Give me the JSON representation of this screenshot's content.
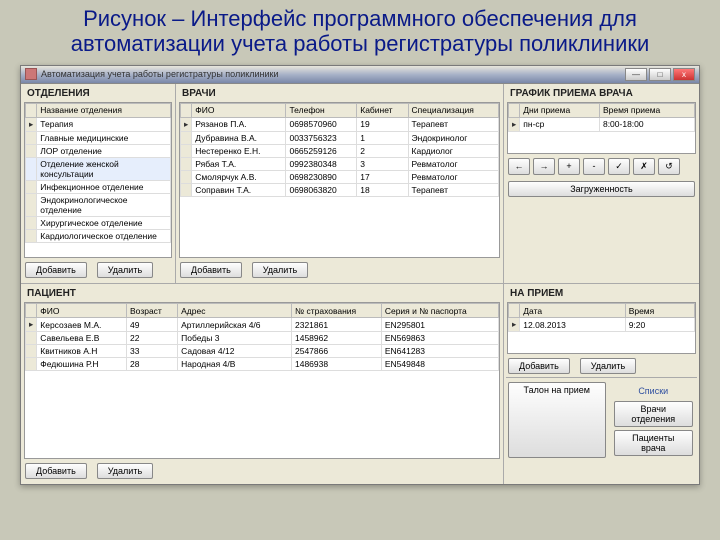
{
  "slide_title": "Рисунок – Интерфейс программного обеспечения для автоматизации учета работы регистратуры поликлиники",
  "window": {
    "title": "Автоматизация учета работы регистратуры поликлиники",
    "min": "—",
    "max": "□",
    "close": "x"
  },
  "dep": {
    "header": "ОТДЕЛЕНИЯ",
    "col": "Название отделения",
    "rows": [
      "Терапия",
      "Главные медицинские",
      "ЛОР отделение",
      "Отделение женской консультации",
      "Инфекционное отделение",
      "Эндокринологическое отделение",
      "Хирургическое отделение",
      "Кардиологическое отделение"
    ],
    "add": "Добавить",
    "del": "Удалить"
  },
  "doc": {
    "header": "ВРАЧИ",
    "cols": [
      "ФИО",
      "Телефон",
      "Кабинет",
      "Специализация"
    ],
    "rows": [
      [
        "Рязанов П.А.",
        "0698570960",
        "19",
        "Терапевт"
      ],
      [
        "Дубравина В.А.",
        "0033756323",
        "1",
        "Эндокринолог"
      ],
      [
        "Нестеренко Е.Н.",
        "0665259126",
        "2",
        "Кардиолог"
      ],
      [
        "Рябая Т.А.",
        "0992380348",
        "3",
        "Ревматолог"
      ],
      [
        "Смолярчук А.В.",
        "0698230890",
        "17",
        "Ревматолог"
      ],
      [
        "Соправин Т.А.",
        "0698063820",
        "18",
        "Терапевт"
      ]
    ],
    "add": "Добавить",
    "del": "Удалить"
  },
  "sched": {
    "header": "ГРАФИК ПРИЕМА ВРАЧА",
    "cols": [
      "Дни приема",
      "Время приема"
    ],
    "rows": [
      [
        "пн-ср",
        "8:00-18:00"
      ]
    ],
    "nav": [
      "←",
      "→",
      "+",
      "-",
      "✓",
      "✗",
      "↺"
    ],
    "load": "Загруженность"
  },
  "pat": {
    "header": "ПАЦИЕНТ",
    "cols": [
      "ФИО",
      "Возраст",
      "Адрес",
      "№ страхования",
      "Серия и № паспорта"
    ],
    "rows": [
      [
        "Керсозаев М.А.",
        "49",
        "Артиллерийская 4/6",
        "2321861",
        "EN295801"
      ],
      [
        "Савельева Е.В",
        "22",
        "Победы 3",
        "1458962",
        "EN569863"
      ],
      [
        "Квитников А.Н",
        "33",
        "Садовая 4/12",
        "2547866",
        "EN641283"
      ],
      [
        "Федюшина Р.Н",
        "28",
        "Народная 4/В",
        "1486938",
        "EN549848"
      ]
    ],
    "add": "Добавить",
    "del": "Удалить"
  },
  "appt": {
    "header": "НА ПРИЕМ",
    "cols": [
      "Дата",
      "Время"
    ],
    "rows": [
      [
        "12.08.2013",
        "9:20"
      ]
    ],
    "add": "Добавить",
    "del": "Удалить",
    "talon": "Талон на прием",
    "lists": "Списки",
    "list1": "Врачи отделения",
    "list2": "Пациенты врача"
  }
}
